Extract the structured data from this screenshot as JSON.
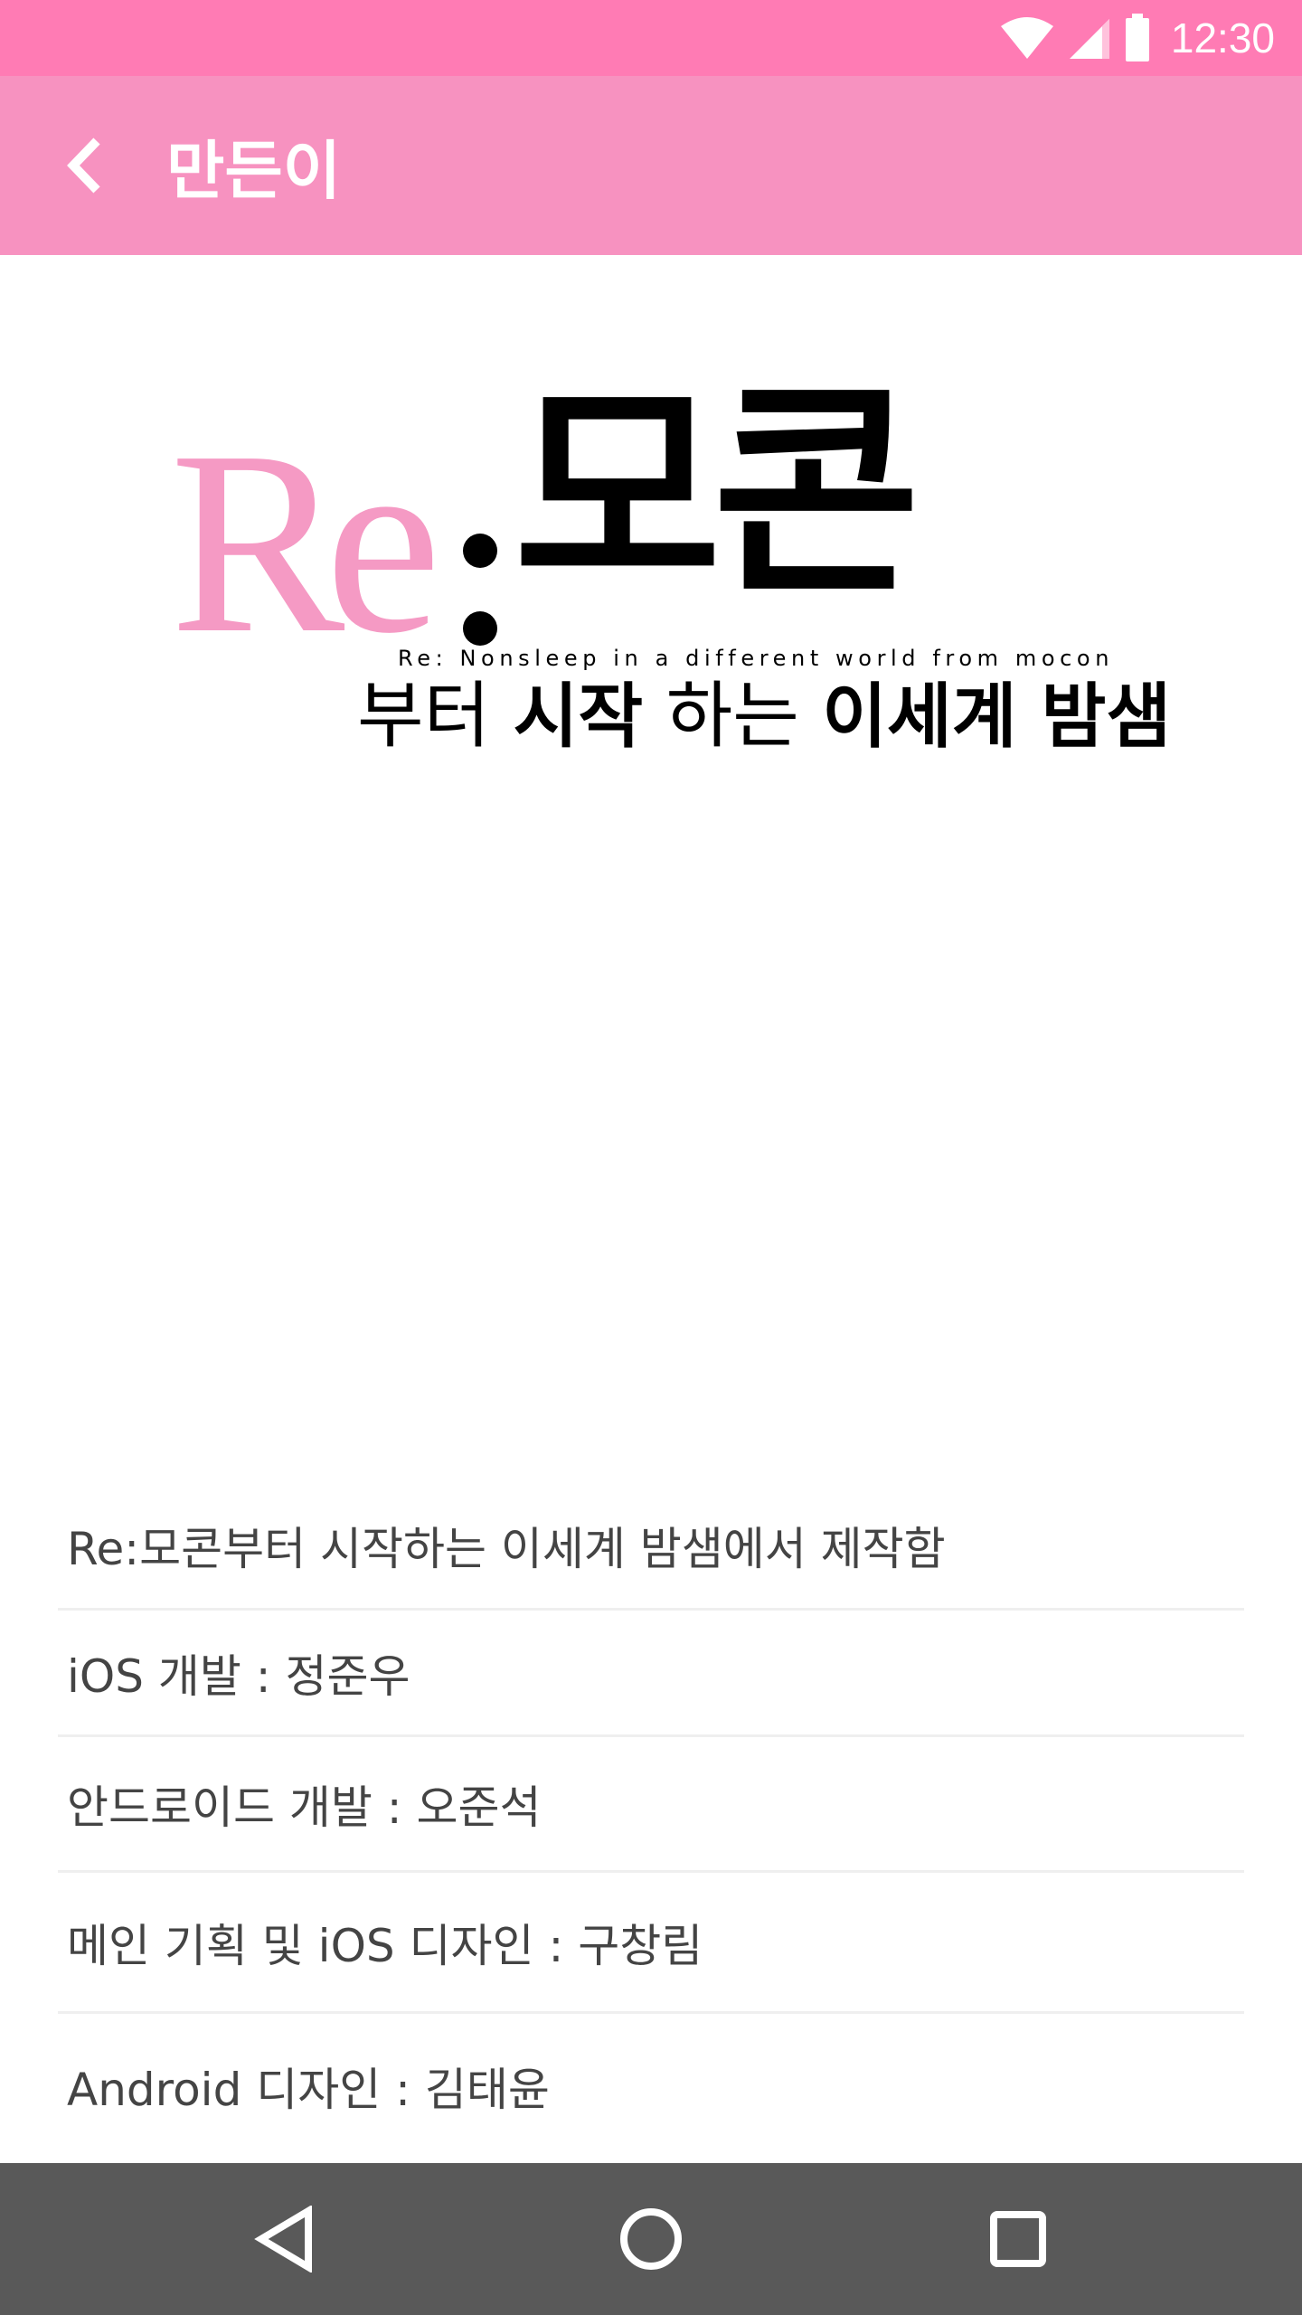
{
  "status_bar": {
    "time": "12:30",
    "icons": [
      "wifi-icon",
      "signal-icon",
      "battery-icon"
    ],
    "background": "#ff7bb4"
  },
  "app_bar": {
    "title": "만든이",
    "back_icon": "chevron-left-icon",
    "background": "#f792c0"
  },
  "logo": {
    "re": "Re",
    "mocon": "모콘",
    "subtitle_en": "Re: Nonsleep in a different world from mocon",
    "subtitle_ko": {
      "part1": "부터 ",
      "part2": "시작",
      "part3": " 하는 ",
      "part4": "이세계",
      "part5": " 밤샘"
    },
    "accent": "#f59ac4"
  },
  "credits": [
    "Re:모콘부터 시작하는 이세계 밤샘에서 제작함",
    "iOS 개발 : 정준우",
    "안드로이드 개발 : 오준석",
    "메인 기획 및 iOS 디자인 : 구창림",
    "Android 디자인 : 김태윤"
  ],
  "nav_bar": {
    "buttons": [
      "back-triangle-icon",
      "home-circle-icon",
      "recents-square-icon"
    ],
    "background": "#595959"
  }
}
